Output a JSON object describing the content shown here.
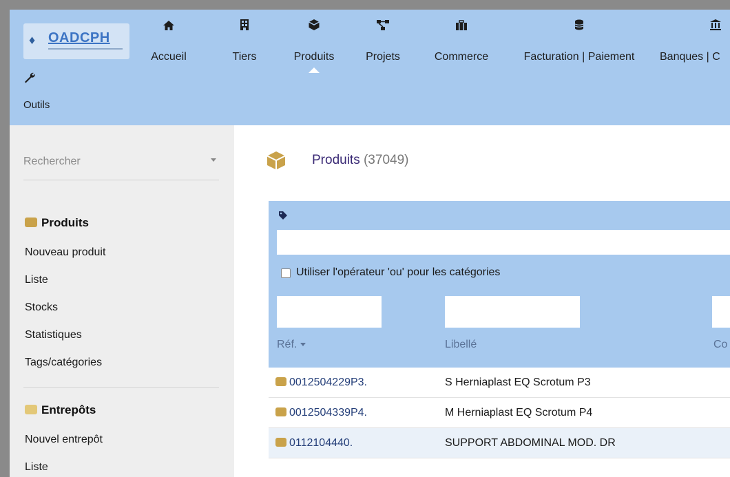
{
  "topbar": {
    "logo_text": "OADCPH",
    "menu": [
      {
        "label": "Accueil",
        "icon": "home-icon"
      },
      {
        "label": "Tiers",
        "icon": "building-icon"
      },
      {
        "label": "Produits",
        "icon": "cube-icon",
        "active": true
      },
      {
        "label": "Projets",
        "icon": "sitemap-icon"
      },
      {
        "label": "Commerce",
        "icon": "suitcase-icon"
      },
      {
        "label": "Facturation | Paiement",
        "icon": "coins-icon"
      },
      {
        "label": "Banques | C",
        "icon": "bank-icon"
      }
    ],
    "tools": {
      "label": "Outils",
      "icon": "wrench-icon"
    }
  },
  "sidebar": {
    "search_placeholder": "Rechercher",
    "sections": [
      {
        "title": "Produits",
        "icon": "cube-icon",
        "links": [
          "Nouveau produit",
          "Liste",
          "Stocks",
          "Statistiques",
          "Tags/catégories"
        ]
      },
      {
        "title": "Entrepôts",
        "icon": "boxes-icon",
        "links": [
          "Nouvel entrepôt",
          "Liste"
        ]
      }
    ]
  },
  "main": {
    "title": "Produits",
    "count": "(37049)",
    "filter": {
      "or_operator_label": "Utiliser l'opérateur 'ou' pour les catégories"
    },
    "columns": {
      "ref": "Réf.",
      "libelle": "Libellé",
      "co": "Co"
    },
    "rows": [
      {
        "ref": "0012504229P3.",
        "libelle": "S Herniaplast EQ Scrotum P3"
      },
      {
        "ref": "0012504339P4.",
        "libelle": "M Herniaplast EQ Scrotum P4"
      },
      {
        "ref": "0112104440.",
        "libelle": "SUPPORT ABDOMINAL MOD. DR"
      }
    ]
  },
  "colors": {
    "menu_bar": "#a7c9ee",
    "sidebar": "#eeeeee",
    "title": "#3a2a75",
    "link": "#26407a"
  }
}
